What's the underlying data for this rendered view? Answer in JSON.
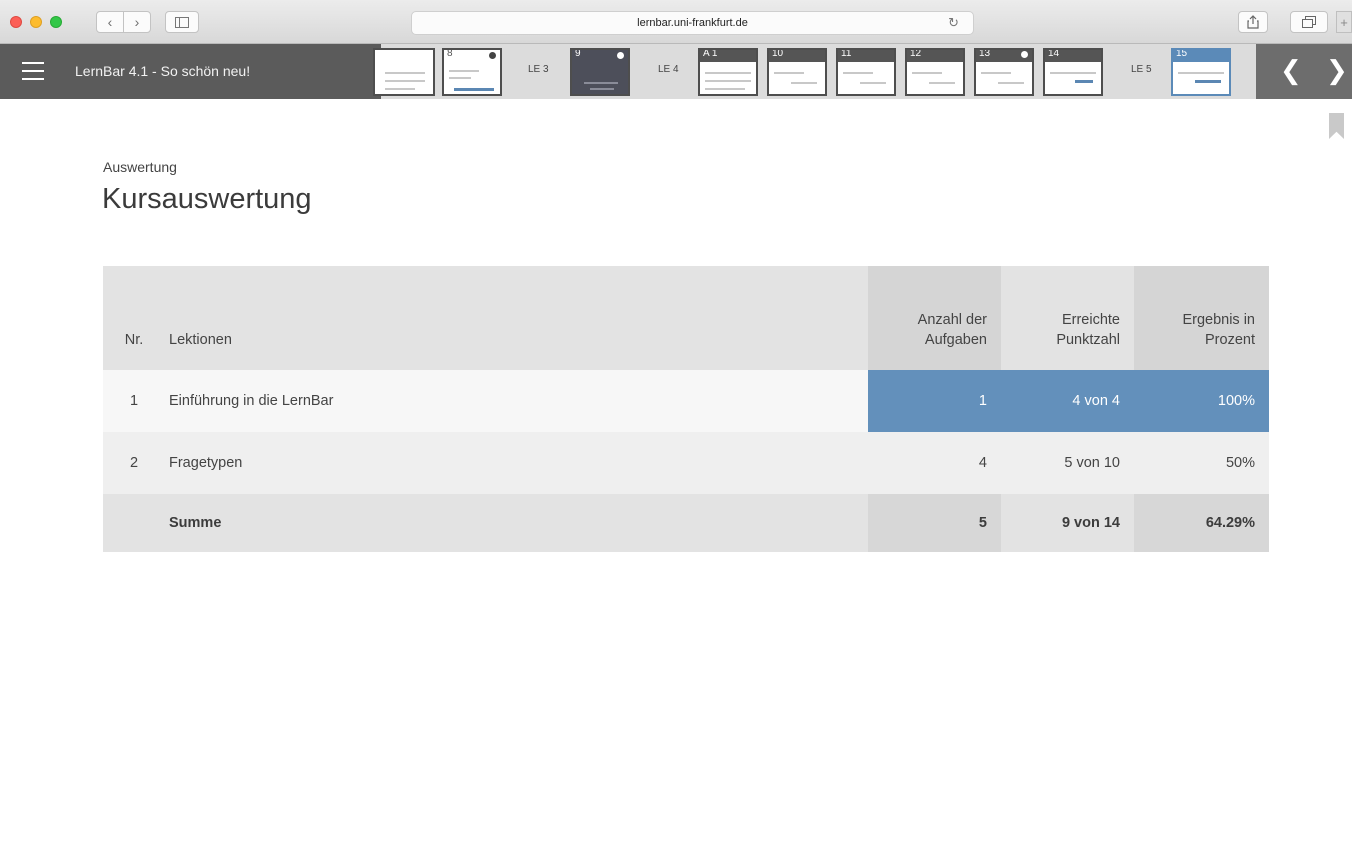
{
  "browser": {
    "url": "lernbar.uni-frankfurt.de"
  },
  "header": {
    "app_title": "LernBar 4.1 - So schön neu!",
    "thumbnails": [
      {
        "num": ""
      },
      {
        "num": "8"
      },
      {
        "le": "LE 3"
      },
      {
        "num": "9"
      },
      {
        "le": "LE 4"
      },
      {
        "num": "A 1"
      },
      {
        "num": "10"
      },
      {
        "num": "11"
      },
      {
        "num": "12"
      },
      {
        "num": "13"
      },
      {
        "num": "14"
      },
      {
        "le": "LE 5"
      },
      {
        "num": "15"
      }
    ],
    "prev_icon": "chevron-left-icon",
    "next_icon": "chevron-right-icon"
  },
  "content": {
    "breadcrumb": "Auswertung",
    "title": "Kursauswertung",
    "table": {
      "headers": {
        "nr": "Nr.",
        "lektionen": "Lektionen",
        "anzahl_line1": "Anzahl der",
        "anzahl_line2": "Aufgaben",
        "punkte_line1": "Erreichte",
        "punkte_line2": "Punktzahl",
        "ergebnis_line1": "Ergebnis in",
        "ergebnis_line2": "Prozent"
      },
      "rows": [
        {
          "nr": "1",
          "lektion": "Einführung in die LernBar",
          "anzahl": "1",
          "punkte": "4 von 4",
          "ergebnis": "100%"
        },
        {
          "nr": "2",
          "lektion": "Fragetypen",
          "anzahl": "4",
          "punkte": "5 von 10",
          "ergebnis": "50%"
        }
      ],
      "summary": {
        "label": "Summe",
        "anzahl": "5",
        "punkte": "9 von 14",
        "ergebnis": "64.29%"
      }
    }
  },
  "colors": {
    "header_bg": "#5b5b5b",
    "highlight_blue": "#6390bb",
    "active_thumb": "#5b8ab8"
  }
}
